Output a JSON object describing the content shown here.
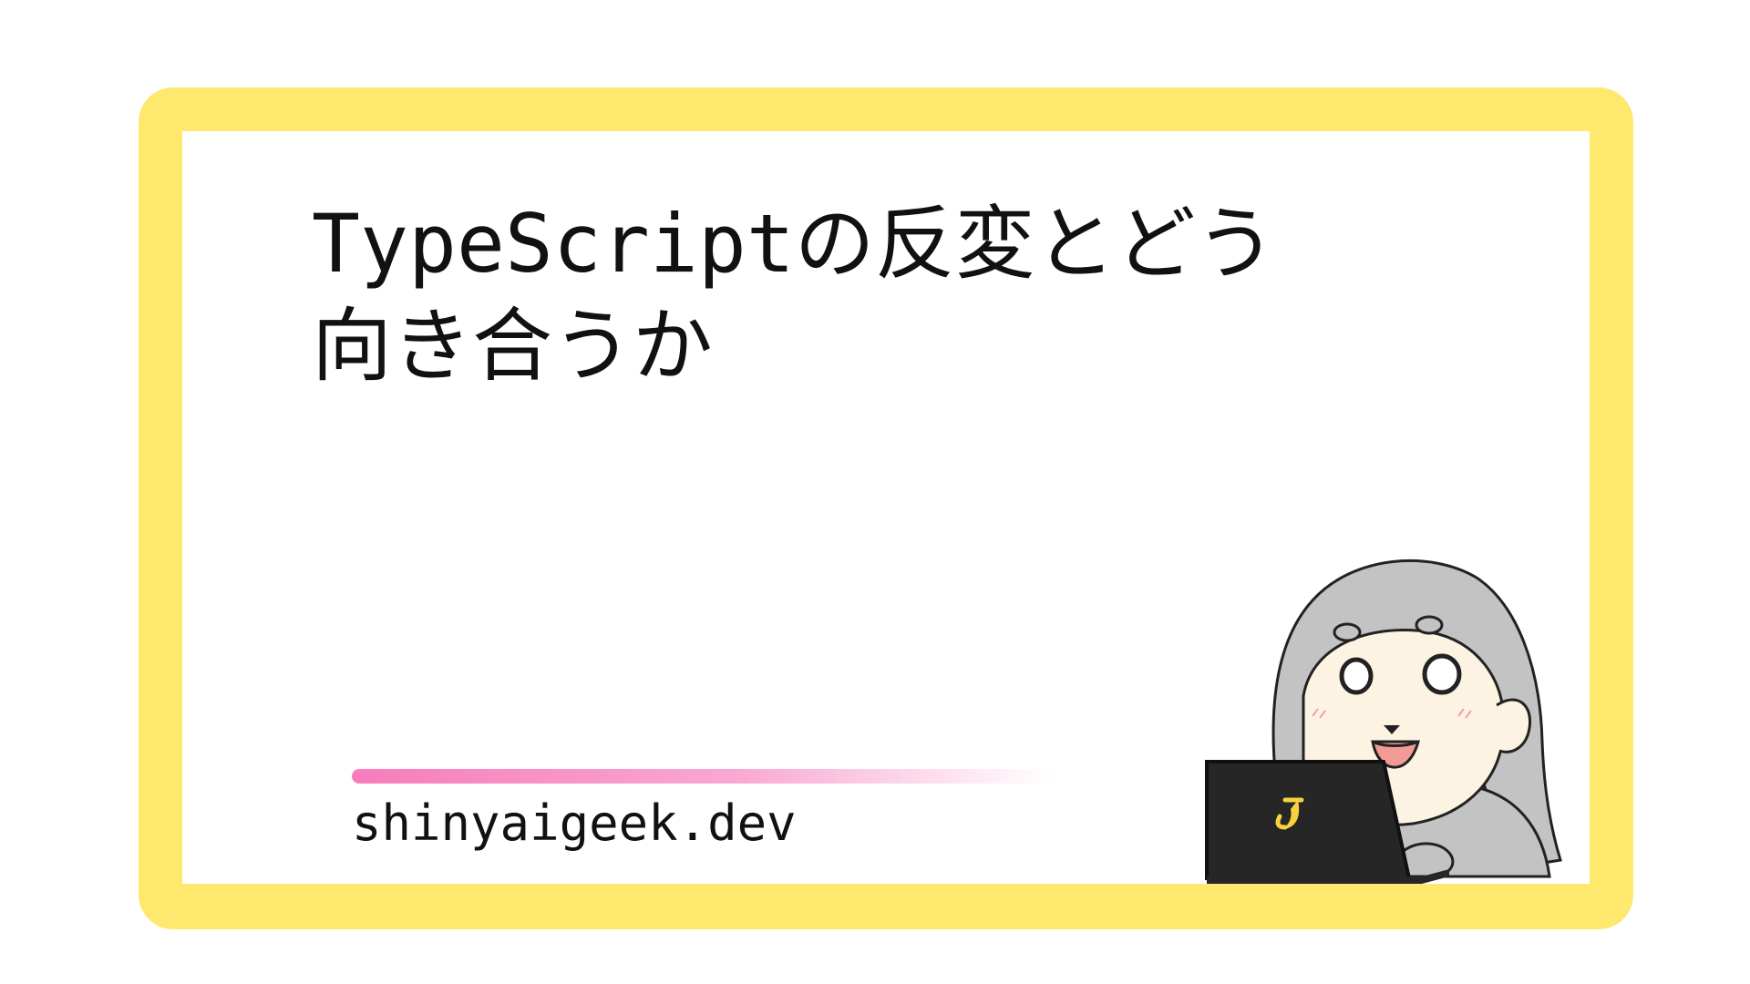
{
  "title": {
    "line1": "TypeScriptの反変とどう",
    "line2": "向き合うか"
  },
  "site": {
    "url": "shinyaigeek.dev"
  },
  "mascot": {
    "icon": "mascot-illustration",
    "laptop_logo_icon": "banana-icon"
  },
  "colors": {
    "frame": "#ffe86e",
    "accent": "#f77cbb",
    "text": "#111111"
  }
}
